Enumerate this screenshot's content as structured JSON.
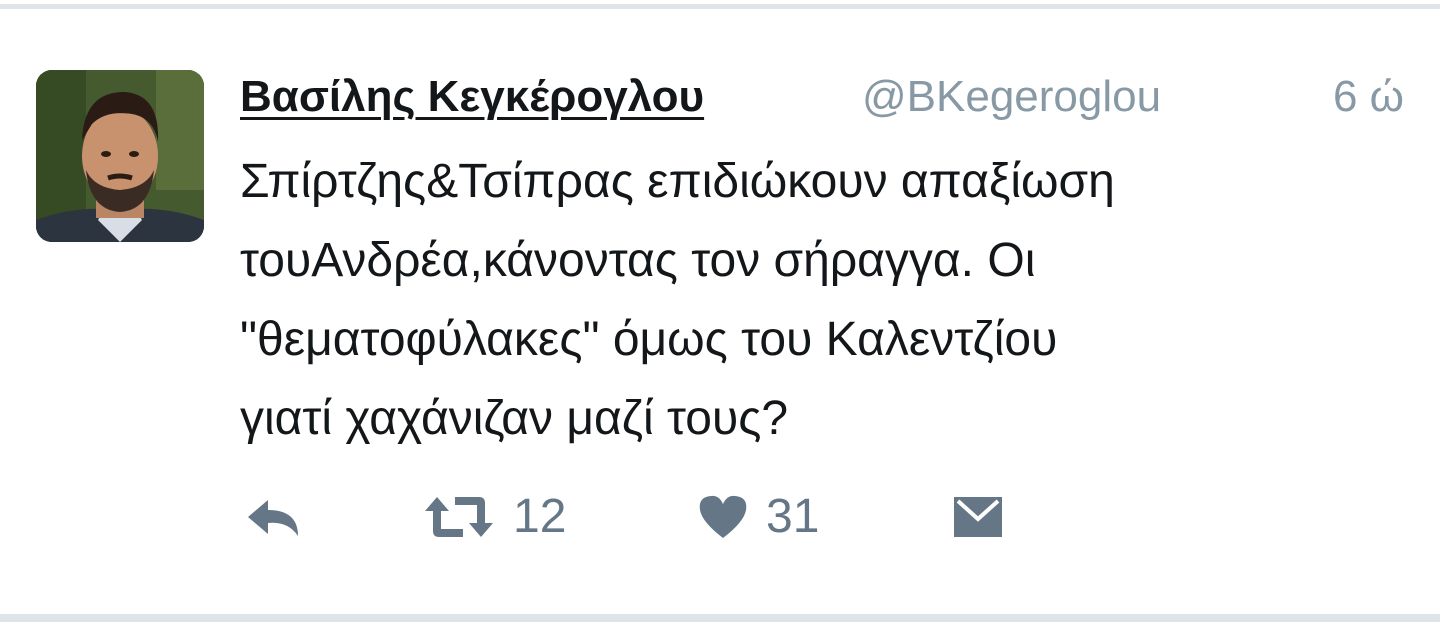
{
  "tweet": {
    "author": {
      "display_name": "Βασίλης Κεγκέρογλου",
      "handle": "@BKegeroglou",
      "avatar_icon": "profile-photo"
    },
    "timestamp": "6 ώ",
    "text_lines": [
      "Σπίρτζης&Τσίπρας επιδιώκουν απαξίωση",
      "τουΑνδρέα,κάνοντας τον σήραγγα. Οι",
      "\"θεματοφύλακες\" όμως του Καλεντζίου",
      "γιατί χαχάνιζαν μαζί τους?"
    ],
    "actions": {
      "reply": {
        "icon": "reply-icon"
      },
      "retweet": {
        "icon": "retweet-icon",
        "count": "12"
      },
      "like": {
        "icon": "heart-icon",
        "count": "31"
      },
      "direct_message": {
        "icon": "envelope-icon"
      }
    }
  },
  "colors": {
    "text": "#14171a",
    "secondary": "#8899a6",
    "icon": "#657786",
    "divider": "#dfe4e9",
    "background": "#ffffff"
  }
}
